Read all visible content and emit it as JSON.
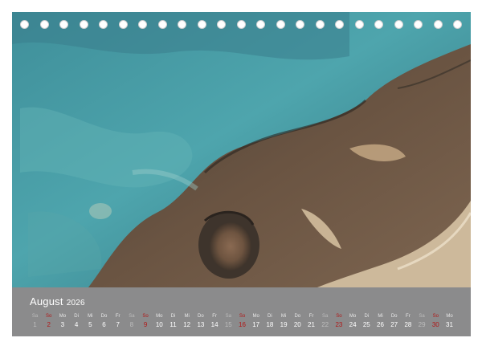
{
  "calendar": {
    "month": "August",
    "year": "2026",
    "weekdays": [
      "Sa",
      "So",
      "Mo",
      "Di",
      "Mi",
      "Do",
      "Fr",
      "Sa",
      "So",
      "Mo",
      "Di",
      "Mi",
      "Do",
      "Fr",
      "Sa",
      "So",
      "Mo",
      "Di",
      "Mi",
      "Do",
      "Fr",
      "Sa",
      "So",
      "Mo",
      "Di",
      "Mi",
      "Do",
      "Fr",
      "Sa",
      "So",
      "Mo"
    ],
    "days": [
      "1",
      "2",
      "3",
      "4",
      "5",
      "6",
      "7",
      "8",
      "9",
      "10",
      "11",
      "12",
      "13",
      "14",
      "15",
      "16",
      "17",
      "18",
      "19",
      "20",
      "21",
      "22",
      "23",
      "24",
      "25",
      "26",
      "27",
      "28",
      "29",
      "30",
      "31"
    ],
    "colors": {
      "sunday": "#b01818",
      "saturday": "#bdbdbd",
      "weekday": "#ffffff"
    }
  },
  "binding": {
    "hole_count": 23
  },
  "photo": {
    "subject": "aerial-landscape"
  }
}
